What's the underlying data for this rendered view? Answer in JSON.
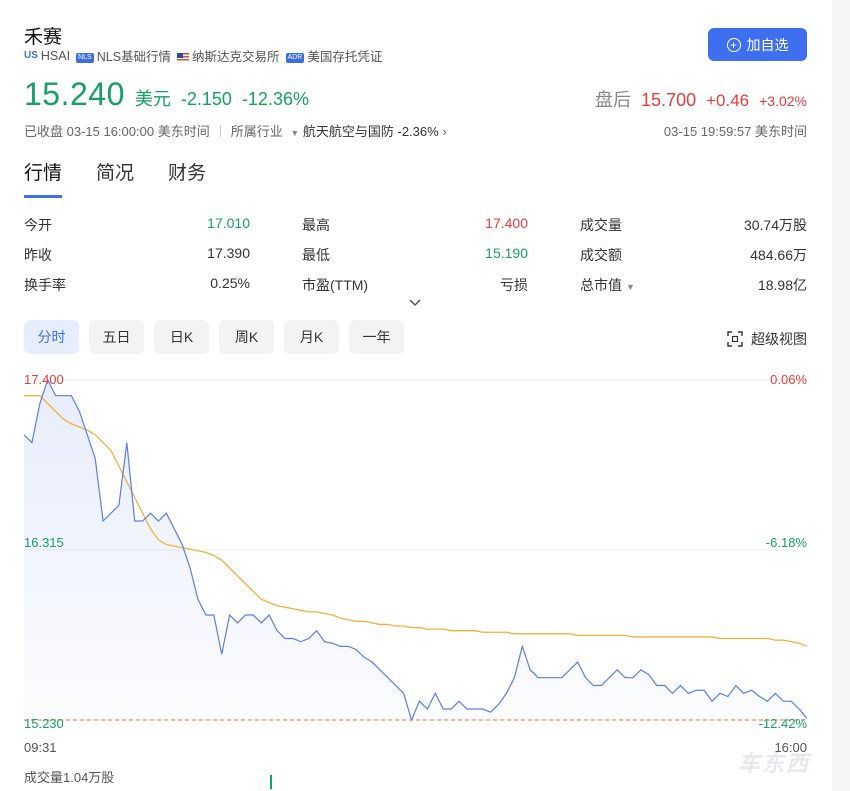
{
  "header": {
    "name": "禾赛",
    "tags": [
      "HSAI",
      "NLS基础行情",
      "纳斯达克交易所",
      "美国存托凭证"
    ],
    "tag_us": "US",
    "tag_nls": "NLS",
    "tag_adr": "ADR",
    "follow_label": "加自选"
  },
  "quote": {
    "price": "15.240",
    "currency": "美元",
    "change": "-2.150",
    "change_pct": "-12.36%",
    "after_label": "盘后",
    "after_price": "15.700",
    "after_change": "+0.46",
    "after_change_pct": "+3.02%",
    "status": "已收盘 03-15 16:00:00 美东时间",
    "industry_label": "所属行业",
    "industry": "航天航空与国防 -2.36%",
    "after_time": "03-15 19:59:57 美东时间"
  },
  "tabs": [
    "行情",
    "简况",
    "财务"
  ],
  "stats": [
    [
      {
        "label": "今开",
        "value": "17.010",
        "color": "green"
      },
      {
        "label": "最高",
        "value": "17.400",
        "color": "red"
      },
      {
        "label": "成交量",
        "value": "30.74万股",
        "color": ""
      }
    ],
    [
      {
        "label": "昨收",
        "value": "17.390",
        "color": ""
      },
      {
        "label": "最低",
        "value": "15.190",
        "color": "green"
      },
      {
        "label": "成交额",
        "value": "484.66万",
        "color": ""
      }
    ],
    [
      {
        "label": "换手率",
        "value": "0.25%",
        "color": ""
      },
      {
        "label": "市盈(TTM)",
        "value": "亏损",
        "color": ""
      },
      {
        "label": "总市值",
        "value": "18.98亿",
        "color": ""
      }
    ]
  ],
  "period_tabs": [
    "分时",
    "五日",
    "日K",
    "周K",
    "月K",
    "一年"
  ],
  "super_view": "超级视图",
  "volume_label": "成交量1.04万股",
  "watermark": "车东西",
  "colors": {
    "up": "#e63c3c",
    "down": "#16a064",
    "price_line": "#5b7fe6",
    "avg_line": "#f0b23c",
    "accent": "#3d6fef"
  },
  "chart_data": {
    "type": "line",
    "y_left_ticks": [
      "17.400",
      "16.315",
      "15.230"
    ],
    "y_right_ticks": [
      "0.06%",
      "-6.18%",
      "-12.42%"
    ],
    "x_ticks": [
      "09:31",
      "16:00"
    ],
    "ylim": [
      15.23,
      17.4
    ],
    "reference_line": 15.23,
    "series": [
      {
        "values": [
          17.05,
          17.0,
          17.25,
          17.4,
          17.3,
          17.3,
          17.3,
          17.2,
          17.05,
          16.9,
          16.5,
          16.55,
          16.6,
          17.0,
          16.5,
          16.5,
          16.55,
          16.5,
          16.55,
          16.45,
          16.35,
          16.2,
          16.0,
          15.9,
          15.9,
          15.65,
          15.9,
          15.85,
          15.9,
          15.9,
          15.85,
          15.9,
          15.8,
          15.75,
          15.75,
          15.73,
          15.75,
          15.8,
          15.73,
          15.72,
          15.7,
          15.7,
          15.68,
          15.63,
          15.6,
          15.55,
          15.5,
          15.45,
          15.4,
          15.23,
          15.35,
          15.3,
          15.4,
          15.3,
          15.3,
          15.35,
          15.3,
          15.3,
          15.3,
          15.28,
          15.33,
          15.4,
          15.5,
          15.7,
          15.55,
          15.5,
          15.5,
          15.5,
          15.5,
          15.55,
          15.6,
          15.5,
          15.45,
          15.45,
          15.5,
          15.55,
          15.5,
          15.5,
          15.55,
          15.52,
          15.45,
          15.45,
          15.4,
          15.45,
          15.4,
          15.42,
          15.42,
          15.35,
          15.4,
          15.38,
          15.45,
          15.4,
          15.42,
          15.38,
          15.35,
          15.4,
          15.35,
          15.35,
          15.3,
          15.24
        ]
      },
      {
        "values": [
          17.3,
          17.3,
          17.3,
          17.25,
          17.2,
          17.15,
          17.12,
          17.1,
          17.08,
          17.05,
          17.0,
          16.95,
          16.85,
          16.75,
          16.65,
          16.55,
          16.45,
          16.38,
          16.35,
          16.34,
          16.33,
          16.32,
          16.31,
          16.3,
          16.28,
          16.25,
          16.2,
          16.15,
          16.1,
          16.05,
          16.0,
          15.98,
          15.96,
          15.95,
          15.94,
          15.93,
          15.92,
          15.92,
          15.91,
          15.9,
          15.88,
          15.87,
          15.86,
          15.86,
          15.85,
          15.84,
          15.84,
          15.83,
          15.83,
          15.82,
          15.82,
          15.81,
          15.81,
          15.81,
          15.8,
          15.8,
          15.8,
          15.8,
          15.79,
          15.79,
          15.79,
          15.79,
          15.78,
          15.78,
          15.78,
          15.78,
          15.78,
          15.78,
          15.78,
          15.78,
          15.77,
          15.77,
          15.77,
          15.77,
          15.77,
          15.77,
          15.77,
          15.76,
          15.76,
          15.76,
          15.76,
          15.76,
          15.76,
          15.76,
          15.76,
          15.76,
          15.76,
          15.76,
          15.75,
          15.75,
          15.75,
          15.75,
          15.75,
          15.75,
          15.75,
          15.74,
          15.74,
          15.73,
          15.72,
          15.7
        ]
      }
    ]
  }
}
